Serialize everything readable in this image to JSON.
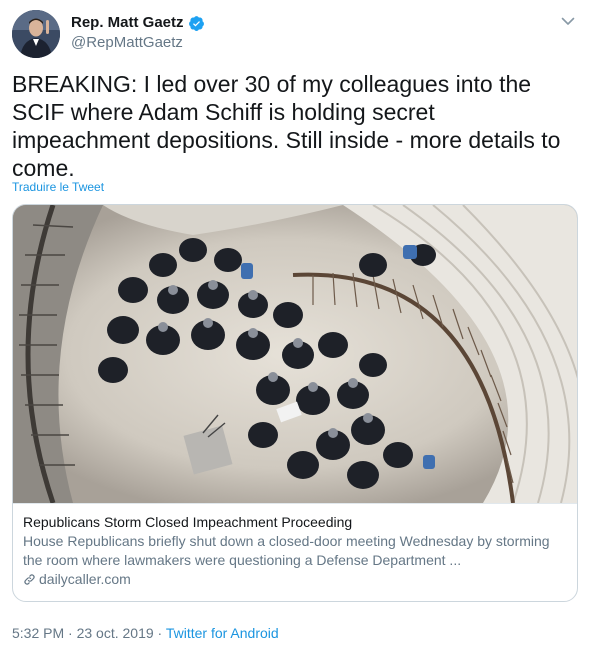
{
  "author": {
    "name": "Rep. Matt Gaetz",
    "handle": "@RepMattGaetz",
    "verified": true
  },
  "tweet": {
    "text": "BREAKING: I led over 30 of my colleagues into the SCIF where Adam Schiff is holding secret impeachment depositions. Still inside - more details to come.",
    "translate_label": "Traduire le Tweet"
  },
  "card": {
    "title": "Republicans Storm Closed Impeachment Proceeding",
    "description": "House Republicans briefly shut down a closed-door meeting Wednesday by storming the room where lawmakers were questioning a Defense Department ...",
    "domain": "dailycaller.com"
  },
  "meta": {
    "time": "5:32 PM",
    "separator": "·",
    "date": "23 oct. 2019",
    "source": "Twitter for Android"
  },
  "icons": {
    "verified": "verified-badge-icon",
    "caret": "chevron-down-icon",
    "link": "link-icon"
  },
  "colors": {
    "link_blue": "#1b95e0",
    "verified_blue": "#1da1f2",
    "secondary_text": "#657786",
    "primary_text": "#14171a",
    "border": "#ccd6dd"
  }
}
